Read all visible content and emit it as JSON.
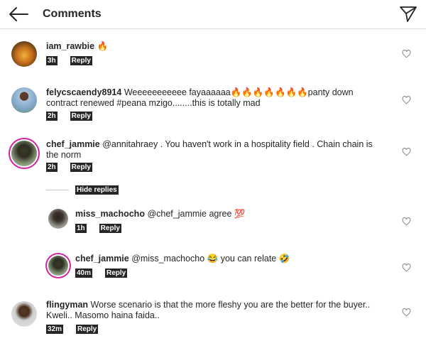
{
  "header": {
    "title": "Comments",
    "back_icon": "arrow-left-icon",
    "send_icon": "send-icon"
  },
  "comments": [
    {
      "user": "iam_rawbie",
      "text": " 🔥",
      "time": "3h",
      "reply": "Reply"
    },
    {
      "user": "felycscaendy8914",
      "text": " Weeeeeeeeeee fayaaaaaa🔥🔥🔥🔥🔥🔥🔥panty down contract renewed #peana mzigo........this is totally mad",
      "time": "2h",
      "reply": "Reply"
    },
    {
      "user": "chef_jammie",
      "text": " @annitahraey .  You haven't work in a hospitality field . Chain chain is the norm",
      "time": "2h",
      "reply": "Reply"
    },
    {
      "user": "miss_machocho",
      "text": " @chef_jammie agree 💯",
      "time": "1h",
      "reply": "Reply"
    },
    {
      "user": "chef_jammie",
      "text": " @miss_machocho 😂  you can relate 🤣",
      "time": "40m",
      "reply": "Reply"
    },
    {
      "user": "flingyman",
      "text": " Worse scenario is that the more fleshy you are the better for the buyer.. Kweli.. Masomo haina faida..",
      "time": "32m",
      "reply": "Reply"
    }
  ],
  "hide_replies": "Hide replies",
  "colors": {
    "ring": "#d6249f",
    "text": "#262626",
    "divider": "#dbdbdb"
  }
}
